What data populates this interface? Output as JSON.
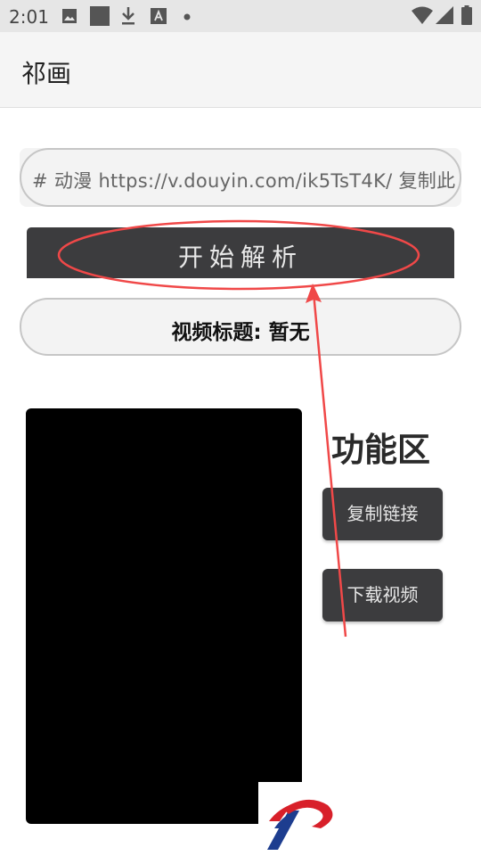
{
  "status_bar": {
    "time": "2:01",
    "icons": [
      "image-icon",
      "square-icon",
      "download-icon",
      "text-a-icon",
      "dot-icon",
      "wifi-icon",
      "signal-icon",
      "battery-icon"
    ]
  },
  "app_bar": {
    "title": "祁画"
  },
  "url_input": {
    "value": "# 动漫  https://v.douyin.com/ik5TsT4K/ 复制此"
  },
  "parse_button": {
    "label": "开始解析"
  },
  "video_title": {
    "text": "视频标题: 暂无"
  },
  "function_area": {
    "title": "功能区",
    "copy_link_label": "复制链接",
    "download_label": "下载视频"
  },
  "colors": {
    "button_bg": "#3c3c3e",
    "annotation_red": "#f04848",
    "logo_red": "#d8202a",
    "logo_blue": "#1d3d8f"
  }
}
